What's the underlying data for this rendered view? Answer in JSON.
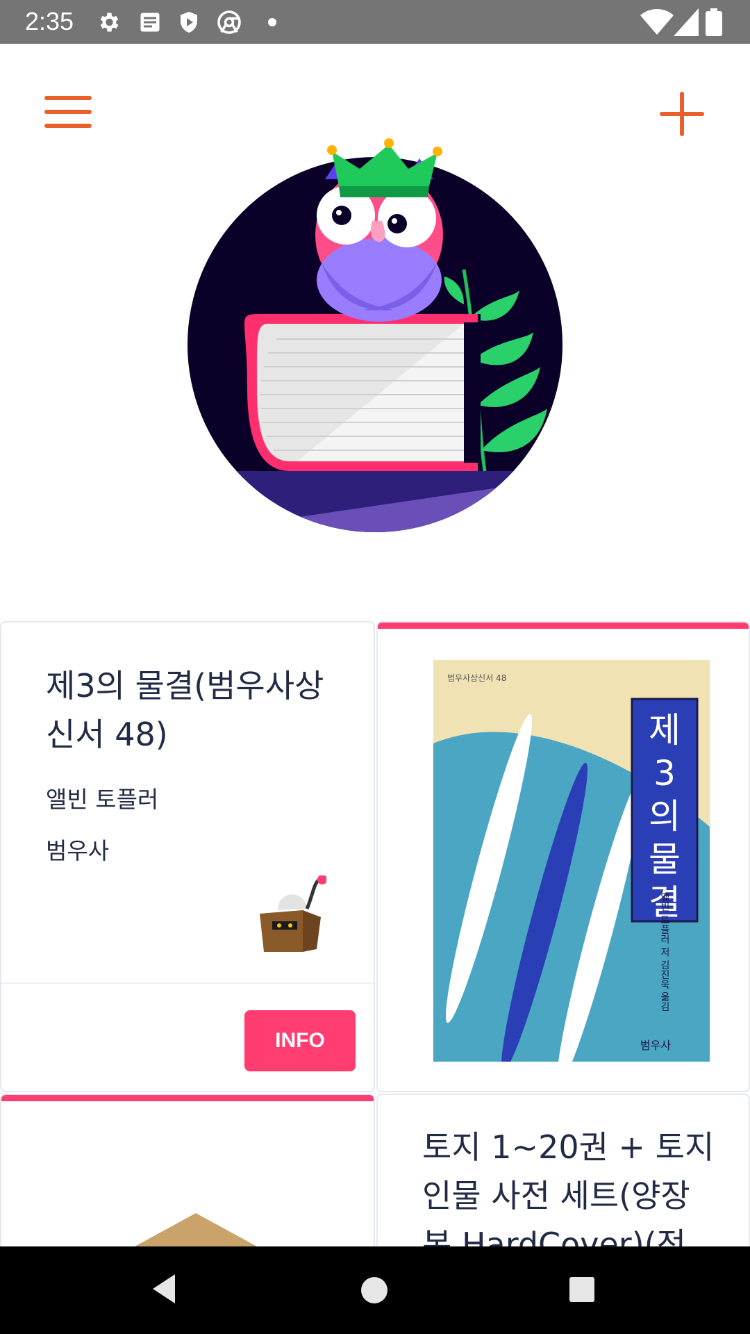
{
  "status_bar": {
    "time": "2:35",
    "icons": [
      "settings-icon",
      "notes-icon",
      "shield-icon",
      "chrome-icon",
      "dot-icon",
      "wifi-icon",
      "signal-icon",
      "battery-icon"
    ]
  },
  "app_bar": {
    "menu_icon": "hamburger-menu-icon",
    "add_icon": "plus-icon",
    "accent_color": "#E8602C"
  },
  "cards": [
    {
      "title": "제3의 물결(범우사상신서 48)",
      "title_line1": "제3의 물결(범우사상",
      "title_line2": "신서 48)",
      "author": "앨빈 토플러",
      "publisher": "범우사",
      "button_label": "INFO"
    },
    {
      "cover_title": "제3의물결",
      "cover_title_chars": [
        "제",
        "3",
        "의",
        "물",
        "결"
      ],
      "cover_series": "범우사상신서 48",
      "cover_author": "앨빈 토플러 저  김진욱 옮김",
      "cover_publisher": "범우사"
    },
    {
      "title_line1": "토지 1~20권 + 토지",
      "title_line2": "인물 사전 세트(양장",
      "title_line3": "본 HardCover)(전"
    }
  ],
  "colors": {
    "accent_pink": "#ff3d71",
    "text_dark": "#222b45",
    "status_bar": "#757575"
  }
}
